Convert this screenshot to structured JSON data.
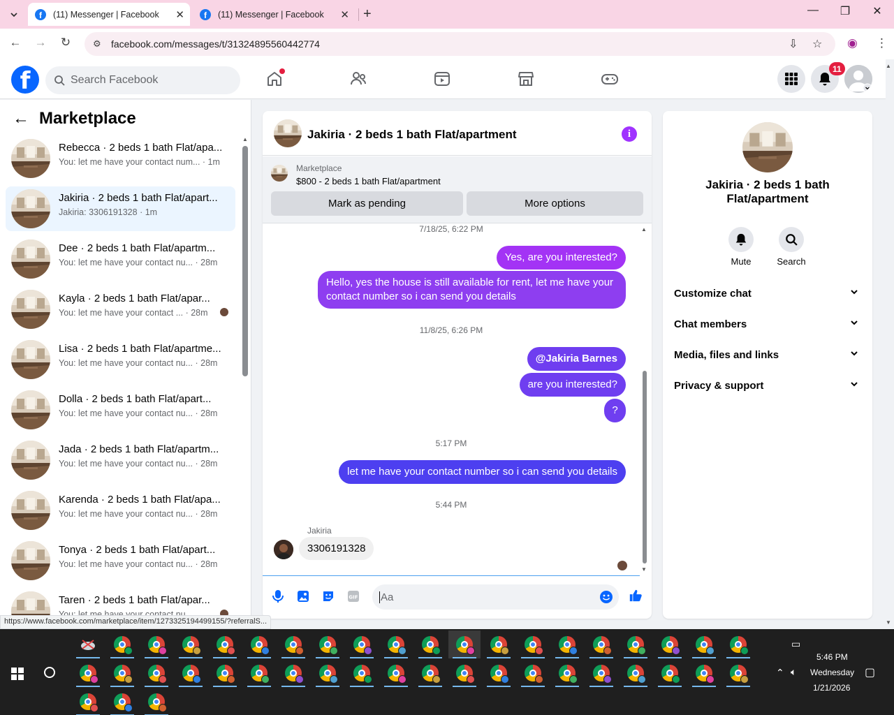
{
  "browser": {
    "tabs": [
      {
        "title": "(11) Messenger | Facebook",
        "active": true
      },
      {
        "title": "(11) Messenger | Facebook",
        "active": false
      }
    ],
    "new_tab_label": "+",
    "url": "facebook.com/messages/t/31324895560442774",
    "status_url": "https://www.facebook.com/marketplace/item/1273325194499155/?referralS..."
  },
  "fb": {
    "search_placeholder": "Search Facebook",
    "notification_count": "11",
    "logo_letter": "f"
  },
  "sidebar": {
    "title": "Marketplace",
    "back_glyph": "←",
    "conversations": [
      {
        "name": "Rebecca · 2 beds 1 bath Flat/apa...",
        "preview": "You: let me have your contact num...",
        "time": "1m",
        "selected": false,
        "seen": false
      },
      {
        "name": "Jakiria · 2 beds 1 bath Flat/apart...",
        "preview": "Jakiria: 3306191328",
        "time": "1m",
        "selected": true,
        "seen": false
      },
      {
        "name": "Dee · 2 beds 1 bath Flat/apartm...",
        "preview": "You: let me have your contact nu...",
        "time": "28m",
        "selected": false,
        "seen": false
      },
      {
        "name": "Kayla · 2 beds 1 bath Flat/apar...",
        "preview": "You: let me have your contact ...",
        "time": "28m",
        "selected": false,
        "seen": true
      },
      {
        "name": "Lisa · 2 beds 1 bath Flat/apartme...",
        "preview": "You: let me have your contact nu...",
        "time": "28m",
        "selected": false,
        "seen": false
      },
      {
        "name": "Dolla · 2 beds 1 bath Flat/apart...",
        "preview": "You: let me have your contact nu...",
        "time": "28m",
        "selected": false,
        "seen": false
      },
      {
        "name": "Jada · 2 beds 1 bath Flat/apartm...",
        "preview": "You: let me have your contact nu...",
        "time": "28m",
        "selected": false,
        "seen": false
      },
      {
        "name": "Karenda · 2 beds 1 bath Flat/apa...",
        "preview": "You: let me have your contact nu...",
        "time": "28m",
        "selected": false,
        "seen": false
      },
      {
        "name": "Tonya · 2 beds 1 bath Flat/apart...",
        "preview": "You: let me have your contact nu...",
        "time": "28m",
        "selected": false,
        "seen": false
      },
      {
        "name": "Taren · 2 beds 1 bath Flat/apar...",
        "preview": "You: let me have your contact nu...",
        "time": "",
        "selected": false,
        "seen": true
      }
    ]
  },
  "chat": {
    "title": "Jakiria · 2 beds 1 bath Flat/apartment",
    "info_glyph": "i",
    "marketplace_label": "Marketplace",
    "listing": "$800 - 2 beds 1 bath Flat/apartment",
    "mark_pending": "Mark as pending",
    "more_options": "More options",
    "timestamps": [
      "7/18/25, 6:22 PM",
      "11/8/25, 6:26 PM",
      "5:17 PM",
      "5:44 PM"
    ],
    "messages": [
      {
        "text": "Yes, are you interested?"
      },
      {
        "text": "Hello, yes the house is still available for rent, let me have your contact number so i can send you details"
      },
      {
        "text": "@Jakiria Barnes"
      },
      {
        "text": "are you interested?"
      },
      {
        "text": "?"
      },
      {
        "text": "let me have your contact number so i can send you details"
      }
    ],
    "incoming_sender": "Jakiria",
    "incoming_text": "3306191328",
    "composer_placeholder": "Aa"
  },
  "info_panel": {
    "name": "Jakiria · 2 beds 1 bath Flat/apartment",
    "mute_label": "Mute",
    "search_label": "Search",
    "sections": [
      "Customize chat",
      "Chat members",
      "Media, files and links",
      "Privacy & support"
    ]
  },
  "taskbar": {
    "time": "5:46 PM",
    "day": "Wednesday",
    "date": "1/21/2026",
    "profile_colors": [
      "#0f9d58",
      "#e040a0",
      "#c8a040",
      "#e05050",
      "#3080e0",
      "#d06030",
      "#40b060",
      "#9050d0",
      "#50a0d0"
    ]
  }
}
